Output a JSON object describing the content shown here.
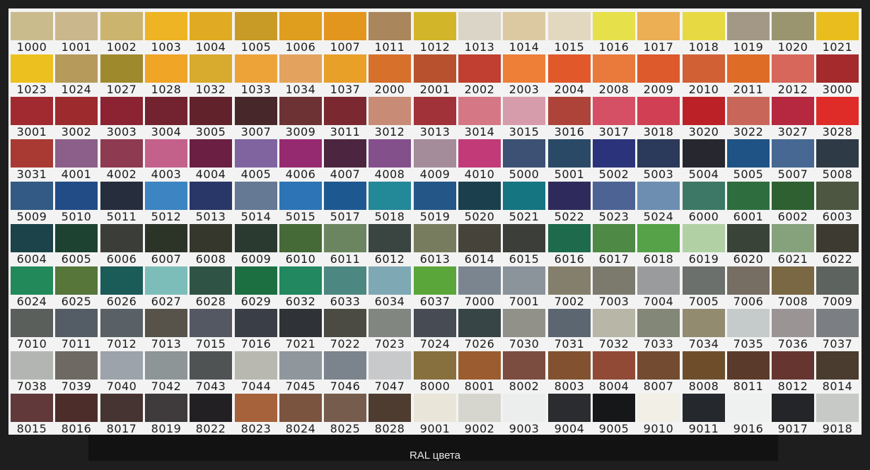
{
  "caption": "RAL цвета",
  "rows": [
    [
      {
        "code": "1000",
        "color": "#c9bb8c"
      },
      {
        "code": "1001",
        "color": "#cbb78c"
      },
      {
        "code": "1002",
        "color": "#cbb46e"
      },
      {
        "code": "1003",
        "color": "#eeb424"
      },
      {
        "code": "1004",
        "color": "#e0ab22"
      },
      {
        "code": "1005",
        "color": "#c89b26"
      },
      {
        "code": "1006",
        "color": "#e09e1e"
      },
      {
        "code": "1007",
        "color": "#e3961d"
      },
      {
        "code": "1011",
        "color": "#a9865b"
      },
      {
        "code": "1012",
        "color": "#d3b529"
      },
      {
        "code": "1013",
        "color": "#dad5c6"
      },
      {
        "code": "1014",
        "color": "#dcc9a2"
      },
      {
        "code": "1015",
        "color": "#e2d8bf"
      },
      {
        "code": "1016",
        "color": "#e6e04a"
      },
      {
        "code": "1017",
        "color": "#ecaf54"
      },
      {
        "code": "1018",
        "color": "#e7d942"
      },
      {
        "code": "1019",
        "color": "#a39886"
      },
      {
        "code": "1020",
        "color": "#9a956e"
      },
      {
        "code": "1021",
        "color": "#e9bd1e"
      }
    ],
    [
      {
        "code": "1023",
        "color": "#ecc11f"
      },
      {
        "code": "1024",
        "color": "#b59a5b"
      },
      {
        "code": "1027",
        "color": "#9e8a2c"
      },
      {
        "code": "1028",
        "color": "#f0a526"
      },
      {
        "code": "1032",
        "color": "#d8ab2e"
      },
      {
        "code": "1033",
        "color": "#eea339"
      },
      {
        "code": "1034",
        "color": "#e3a35e"
      },
      {
        "code": "1037",
        "color": "#e8a029"
      },
      {
        "code": "2000",
        "color": "#d6702a"
      },
      {
        "code": "2001",
        "color": "#b8512d"
      },
      {
        "code": "2002",
        "color": "#c03f30"
      },
      {
        "code": "2003",
        "color": "#ee7f37"
      },
      {
        "code": "2004",
        "color": "#e1592a"
      },
      {
        "code": "2008",
        "color": "#e97a3b"
      },
      {
        "code": "2009",
        "color": "#dc5a2b"
      },
      {
        "code": "2010",
        "color": "#d16134"
      },
      {
        "code": "2011",
        "color": "#df6c26"
      },
      {
        "code": "2012",
        "color": "#d7675a"
      },
      {
        "code": "3000",
        "color": "#a52a2c"
      }
    ],
    [
      {
        "code": "3001",
        "color": "#a12a30"
      },
      {
        "code": "3002",
        "color": "#9d2a2d"
      },
      {
        "code": "3003",
        "color": "#8b2332"
      },
      {
        "code": "3004",
        "color": "#73232f"
      },
      {
        "code": "3005",
        "color": "#62222c"
      },
      {
        "code": "3007",
        "color": "#47272a"
      },
      {
        "code": "3009",
        "color": "#6d3234"
      },
      {
        "code": "3011",
        "color": "#7b2830"
      },
      {
        "code": "3012",
        "color": "#c88b75"
      },
      {
        "code": "3013",
        "color": "#a1323a"
      },
      {
        "code": "3014",
        "color": "#d57784"
      },
      {
        "code": "3015",
        "color": "#d79cab"
      },
      {
        "code": "3016",
        "color": "#ae433a"
      },
      {
        "code": "3017",
        "color": "#d55064"
      },
      {
        "code": "3018",
        "color": "#d03f53"
      },
      {
        "code": "3020",
        "color": "#bd2128"
      },
      {
        "code": "3022",
        "color": "#c9665a"
      },
      {
        "code": "3027",
        "color": "#b5283f"
      },
      {
        "code": "3028",
        "color": "#df2c29"
      }
    ],
    [
      {
        "code": "3031",
        "color": "#a83933"
      },
      {
        "code": "4001",
        "color": "#8b5f89"
      },
      {
        "code": "4002",
        "color": "#8e3a50"
      },
      {
        "code": "4003",
        "color": "#c4618b"
      },
      {
        "code": "4004",
        "color": "#6a1f43"
      },
      {
        "code": "4005",
        "color": "#7f64a0"
      },
      {
        "code": "4006",
        "color": "#962a70"
      },
      {
        "code": "4007",
        "color": "#4c2640"
      },
      {
        "code": "4008",
        "color": "#84508b"
      },
      {
        "code": "4009",
        "color": "#a48c9a"
      },
      {
        "code": "4010",
        "color": "#c23b78"
      },
      {
        "code": "5000",
        "color": "#3c5173"
      },
      {
        "code": "5001",
        "color": "#2a4966"
      },
      {
        "code": "5002",
        "color": "#2b347a"
      },
      {
        "code": "5003",
        "color": "#2b3a5a"
      },
      {
        "code": "5004",
        "color": "#26272f"
      },
      {
        "code": "5005",
        "color": "#1f5385"
      },
      {
        "code": "5007",
        "color": "#466892"
      },
      {
        "code": "5008",
        "color": "#2f3a47"
      }
    ],
    [
      {
        "code": "5009",
        "color": "#325a84"
      },
      {
        "code": "5010",
        "color": "#224c86"
      },
      {
        "code": "5011",
        "color": "#262d3d"
      },
      {
        "code": "5012",
        "color": "#3c84c2"
      },
      {
        "code": "5013",
        "color": "#283767"
      },
      {
        "code": "5014",
        "color": "#657894"
      },
      {
        "code": "5015",
        "color": "#2d74b6"
      },
      {
        "code": "5017",
        "color": "#1d5990"
      },
      {
        "code": "5018",
        "color": "#238897"
      },
      {
        "code": "5019",
        "color": "#245688"
      },
      {
        "code": "5020",
        "color": "#1c3f4e"
      },
      {
        "code": "5021",
        "color": "#157580"
      },
      {
        "code": "5022",
        "color": "#2e2b5c"
      },
      {
        "code": "5023",
        "color": "#4c6394"
      },
      {
        "code": "5024",
        "color": "#6d8eb1"
      },
      {
        "code": "6000",
        "color": "#3c7865"
      },
      {
        "code": "6001",
        "color": "#2e6e3e"
      },
      {
        "code": "6002",
        "color": "#2e6031"
      },
      {
        "code": "6003",
        "color": "#4c5640"
      }
    ],
    [
      {
        "code": "6004",
        "color": "#1c4349"
      },
      {
        "code": "6005",
        "color": "#1d4232"
      },
      {
        "code": "6006",
        "color": "#3b3e38"
      },
      {
        "code": "6007",
        "color": "#2c3428"
      },
      {
        "code": "6008",
        "color": "#35362c"
      },
      {
        "code": "6009",
        "color": "#2a3a30"
      },
      {
        "code": "6010",
        "color": "#456a37"
      },
      {
        "code": "6011",
        "color": "#6a8560"
      },
      {
        "code": "6012",
        "color": "#3a4441"
      },
      {
        "code": "6013",
        "color": "#787c5e"
      },
      {
        "code": "6014",
        "color": "#45433a"
      },
      {
        "code": "6015",
        "color": "#3c3f39"
      },
      {
        "code": "6016",
        "color": "#1d6a4c"
      },
      {
        "code": "6017",
        "color": "#4e8946"
      },
      {
        "code": "6018",
        "color": "#55a248"
      },
      {
        "code": "6019",
        "color": "#b1d1a5"
      },
      {
        "code": "6020",
        "color": "#394337"
      },
      {
        "code": "6021",
        "color": "#86a27d"
      },
      {
        "code": "6022",
        "color": "#3d3a32"
      }
    ],
    [
      {
        "code": "6024",
        "color": "#228a5a"
      },
      {
        "code": "6025",
        "color": "#56763a"
      },
      {
        "code": "6026",
        "color": "#1b5b58"
      },
      {
        "code": "6027",
        "color": "#7cbdb9"
      },
      {
        "code": "6028",
        "color": "#2f5445"
      },
      {
        "code": "6029",
        "color": "#1c6f41"
      },
      {
        "code": "6032",
        "color": "#228860"
      },
      {
        "code": "6033",
        "color": "#4c8881"
      },
      {
        "code": "6034",
        "color": "#7ea8b3"
      },
      {
        "code": "6037",
        "color": "#5ba63a"
      },
      {
        "code": "7000",
        "color": "#7a8590"
      },
      {
        "code": "7001",
        "color": "#8b939b"
      },
      {
        "code": "7002",
        "color": "#837f6c"
      },
      {
        "code": "7003",
        "color": "#7b7a6d"
      },
      {
        "code": "7004",
        "color": "#9a9b9c"
      },
      {
        "code": "7005",
        "color": "#6b706c"
      },
      {
        "code": "7006",
        "color": "#766d63"
      },
      {
        "code": "7008",
        "color": "#7a6744"
      },
      {
        "code": "7009",
        "color": "#5d635e"
      }
    ],
    [
      {
        "code": "7010",
        "color": "#5b5f5c"
      },
      {
        "code": "7011",
        "color": "#545d66"
      },
      {
        "code": "7012",
        "color": "#5a6166"
      },
      {
        "code": "7013",
        "color": "#57524a"
      },
      {
        "code": "7015",
        "color": "#535862"
      },
      {
        "code": "7016",
        "color": "#3a3e46"
      },
      {
        "code": "7021",
        "color": "#2f3236"
      },
      {
        "code": "7022",
        "color": "#4b4b44"
      },
      {
        "code": "7023",
        "color": "#818680"
      },
      {
        "code": "7024",
        "color": "#474b53"
      },
      {
        "code": "7026",
        "color": "#374547"
      },
      {
        "code": "7030",
        "color": "#929189"
      },
      {
        "code": "7031",
        "color": "#5b6671"
      },
      {
        "code": "7032",
        "color": "#b7b6a7"
      },
      {
        "code": "7033",
        "color": "#828778"
      },
      {
        "code": "7034",
        "color": "#938b70"
      },
      {
        "code": "7035",
        "color": "#c5cacb"
      },
      {
        "code": "7036",
        "color": "#9b9495"
      },
      {
        "code": "7037",
        "color": "#7b7e82"
      }
    ],
    [
      {
        "code": "7038",
        "color": "#b2b5b1"
      },
      {
        "code": "7039",
        "color": "#6e6a63"
      },
      {
        "code": "7040",
        "color": "#9ca3aa"
      },
      {
        "code": "7042",
        "color": "#8d9596"
      },
      {
        "code": "7043",
        "color": "#4f5354"
      },
      {
        "code": "7044",
        "color": "#b8b7b0"
      },
      {
        "code": "7045",
        "color": "#8f969c"
      },
      {
        "code": "7046",
        "color": "#7b838c"
      },
      {
        "code": "7047",
        "color": "#c8c9cb"
      },
      {
        "code": "8000",
        "color": "#87703d"
      },
      {
        "code": "8001",
        "color": "#9b5c2f"
      },
      {
        "code": "8002",
        "color": "#7b4c40"
      },
      {
        "code": "8003",
        "color": "#82512f"
      },
      {
        "code": "8004",
        "color": "#914a36"
      },
      {
        "code": "8007",
        "color": "#734b30"
      },
      {
        "code": "8008",
        "color": "#6e4e2a"
      },
      {
        "code": "8011",
        "color": "#5a3a2a"
      },
      {
        "code": "8012",
        "color": "#66352f"
      },
      {
        "code": "8014",
        "color": "#4a3c2e"
      }
    ],
    [
      {
        "code": "8015",
        "color": "#61393a"
      },
      {
        "code": "8016",
        "color": "#4c2d29"
      },
      {
        "code": "8017",
        "color": "#463432"
      },
      {
        "code": "8019",
        "color": "#3f3a3c"
      },
      {
        "code": "8022",
        "color": "#222022"
      },
      {
        "code": "8023",
        "color": "#a6623a"
      },
      {
        "code": "8024",
        "color": "#7b5440"
      },
      {
        "code": "8025",
        "color": "#765c4d"
      },
      {
        "code": "8028",
        "color": "#4f3c30"
      },
      {
        "code": "9001",
        "color": "#e9e5d9"
      },
      {
        "code": "9002",
        "color": "#d6d6cf"
      },
      {
        "code": "9003",
        "color": "#eceded"
      },
      {
        "code": "9004",
        "color": "#2b2c2f"
      },
      {
        "code": "9005",
        "color": "#161718"
      },
      {
        "code": "9010",
        "color": "#f1efe6"
      },
      {
        "code": "9011",
        "color": "#25282d"
      },
      {
        "code": "9016",
        "color": "#eff0f0"
      },
      {
        "code": "9017",
        "color": "#242528"
      },
      {
        "code": "9018",
        "color": "#c6c9c6"
      }
    ]
  ]
}
